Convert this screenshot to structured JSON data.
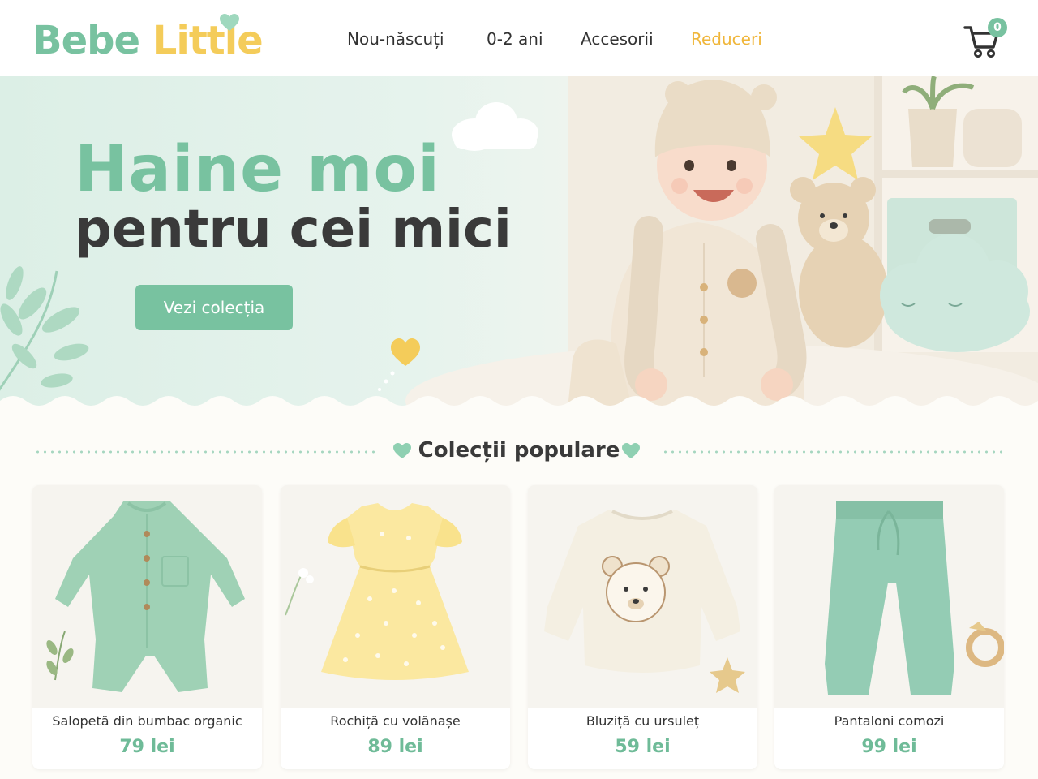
{
  "brand": {
    "part1": "Bebe",
    "part2": "Little",
    "logo_icon": "heart-icon"
  },
  "nav": {
    "items": [
      {
        "label": "Nou-născuți"
      },
      {
        "label": "0-2 ani"
      },
      {
        "label": "Accesorii"
      },
      {
        "label": "Reduceri",
        "highlight": true
      }
    ]
  },
  "cart": {
    "count": "0",
    "icon": "shopping-cart-icon"
  },
  "hero": {
    "title_line1": "Haine moi",
    "title_line2": "pentru cei mici",
    "button_label": "Vezi colecția"
  },
  "collections": {
    "title": "Colecții populare",
    "products": [
      {
        "name": "Salopetă din bumbac organic",
        "price": "79 lei"
      },
      {
        "name": "Rochiță cu volănașe",
        "price": "89 lei"
      },
      {
        "name": "Bluziță cu ursuleț",
        "price": "59 lei"
      },
      {
        "name": "Pantaloni comozi",
        "price": "99 lei"
      }
    ]
  },
  "colors": {
    "brand_green": "#78c2a0",
    "brand_yellow": "#f4cc5a",
    "sale": "#f0b63a",
    "hero_background": "#dcefe6",
    "price": "#6fbb98"
  }
}
